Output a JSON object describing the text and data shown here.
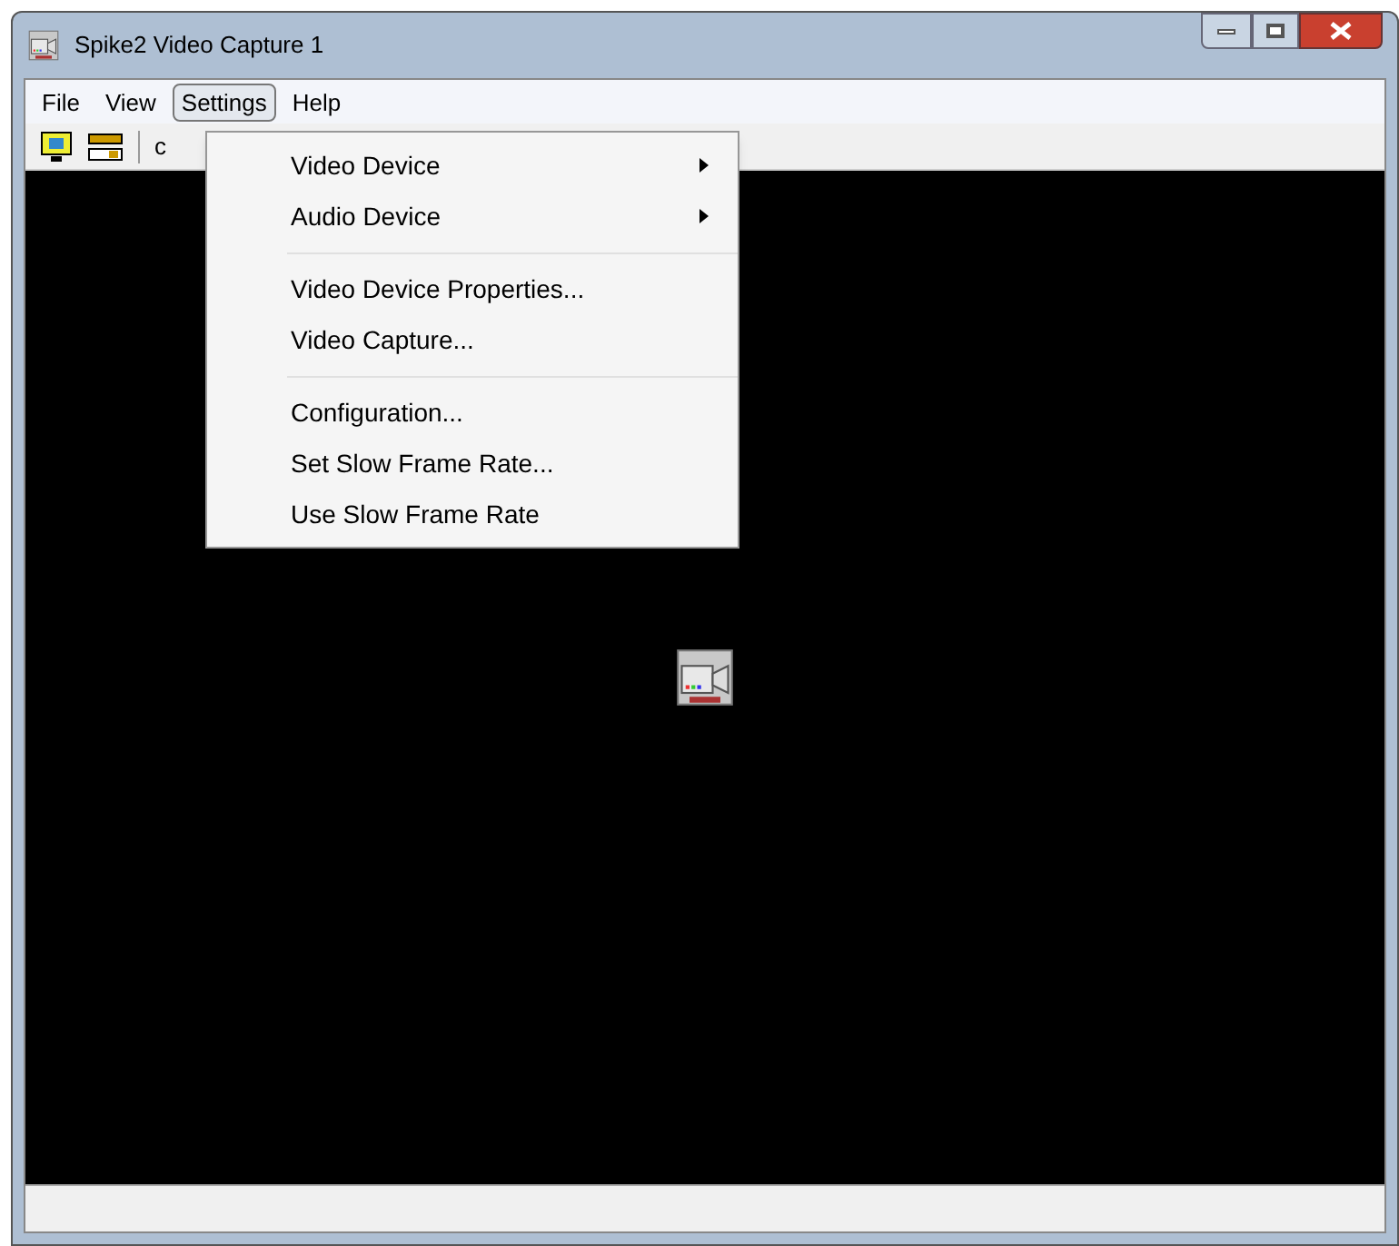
{
  "window": {
    "title": "Spike2 Video Capture 1"
  },
  "menu_bar": [
    {
      "label": "File",
      "selected": false
    },
    {
      "label": "View",
      "selected": false
    },
    {
      "label": "Settings",
      "selected": true
    },
    {
      "label": "Help",
      "selected": false
    }
  ],
  "toolbar": {
    "cut_text": "c"
  },
  "dropdown": [
    {
      "kind": "item",
      "label": "Video Device",
      "submenu": true
    },
    {
      "kind": "item",
      "label": "Audio Device",
      "submenu": true
    },
    {
      "kind": "separator"
    },
    {
      "kind": "item",
      "label": "Video Device Properties...",
      "submenu": false
    },
    {
      "kind": "item",
      "label": "Video Capture...",
      "submenu": false
    },
    {
      "kind": "separator"
    },
    {
      "kind": "item",
      "label": "Configuration...",
      "submenu": false
    },
    {
      "kind": "item",
      "label": "Set Slow Frame Rate...",
      "submenu": false
    },
    {
      "kind": "item",
      "label": "Use Slow Frame Rate",
      "submenu": false
    }
  ]
}
